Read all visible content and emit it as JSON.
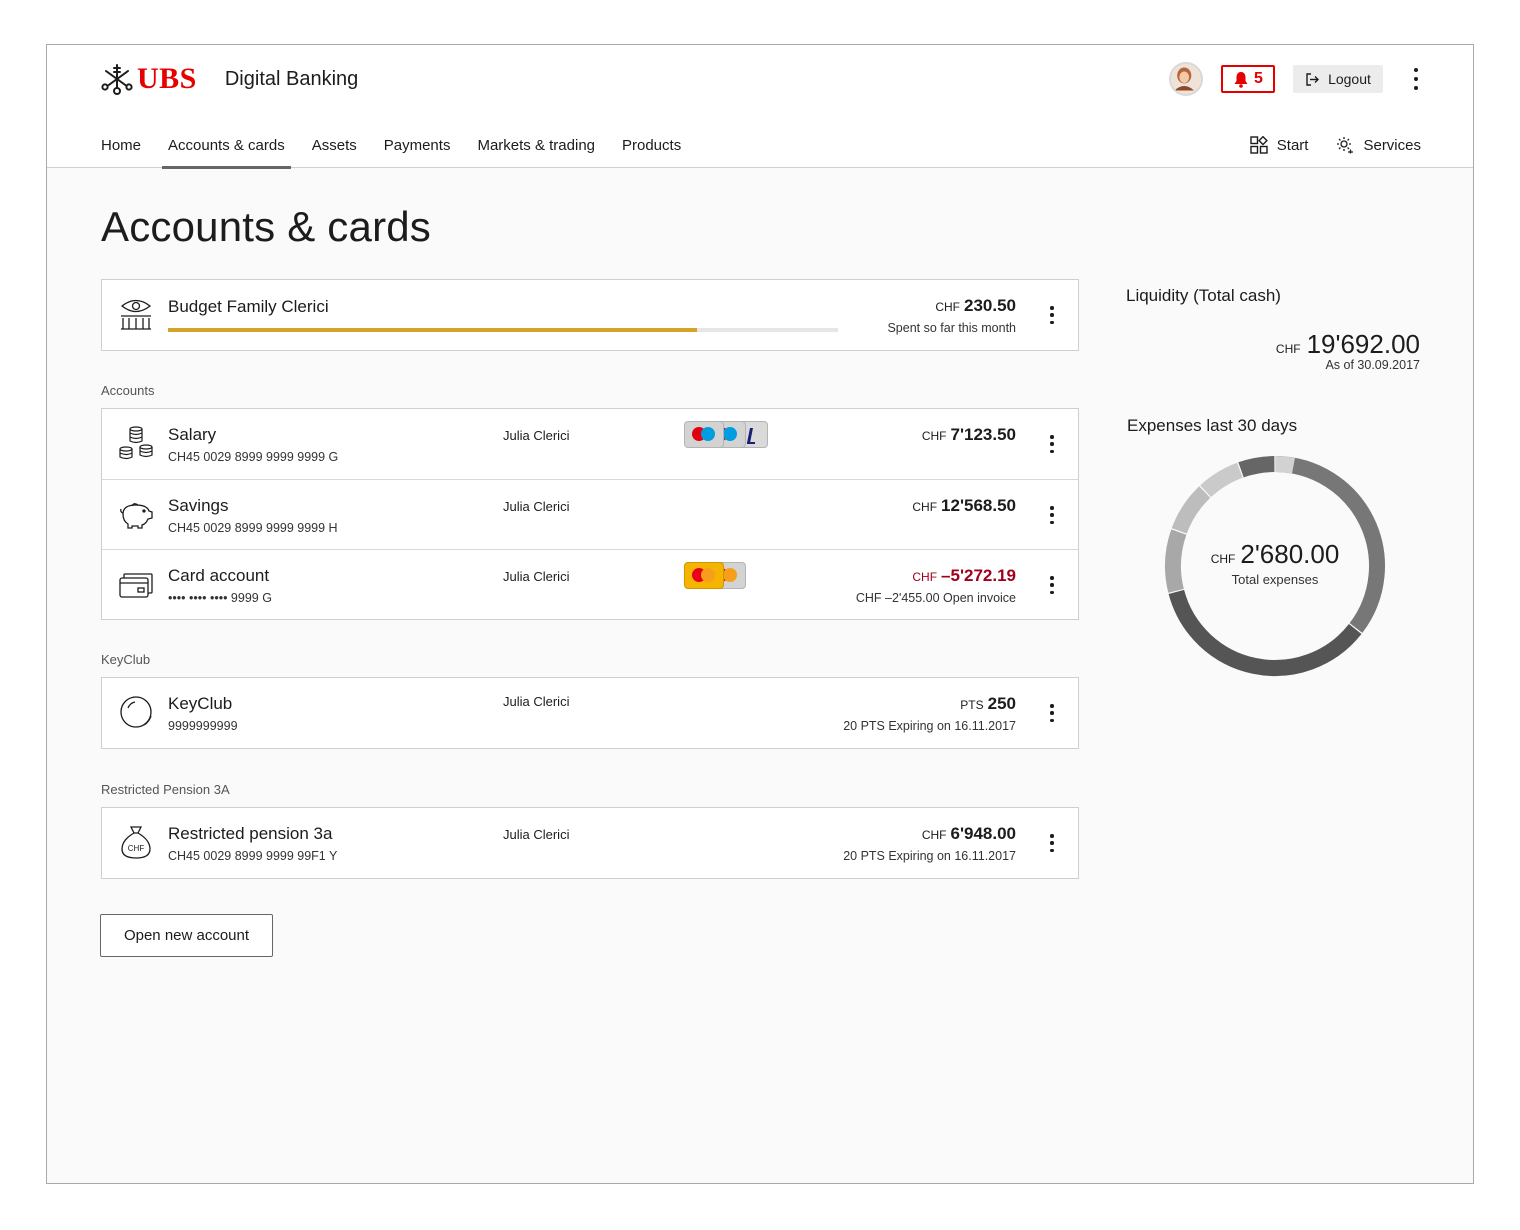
{
  "header": {
    "logo_text": "UBS",
    "app_name": "Digital Banking",
    "notification_count": "5",
    "logout_label": "Logout"
  },
  "nav": {
    "items": [
      {
        "label": "Home"
      },
      {
        "label": "Accounts & cards"
      },
      {
        "label": "Assets"
      },
      {
        "label": "Payments"
      },
      {
        "label": "Markets & trading"
      },
      {
        "label": "Products"
      }
    ],
    "active": "Accounts & cards",
    "start_label": "Start",
    "services_label": "Services"
  },
  "page": {
    "title": "Accounts & cards"
  },
  "budget": {
    "title": "Budget Family Clerici",
    "currency": "CHF",
    "amount": "230.50",
    "note": "Spent so far this month",
    "progress": 0.79,
    "accent_color": "#d4a32a"
  },
  "sections": {
    "accounts": "Accounts",
    "keyclub": "KeyClub",
    "pension": "Restricted Pension 3A"
  },
  "accounts": [
    {
      "title": "Salary",
      "sub": "CH45 0029 8999 9999 9999 G",
      "owner": "Julia Clerici",
      "currency": "CHF",
      "amount": "7'123.50",
      "icon": "coins-icon"
    },
    {
      "title": "Savings",
      "sub": "CH45 0029 8999 9999 9999 H",
      "owner": "Julia Clerici",
      "currency": "CHF",
      "amount": "12'568.50",
      "icon": "piggy-bank-icon"
    },
    {
      "title": "Card account",
      "sub": "•••• •••• •••• 9999 G",
      "owner": "Julia Clerici",
      "currency": "CHF",
      "amount": "–5'272.19",
      "note": "CHF –2'455.00 Open invoice",
      "icon": "cards-icon",
      "amount_color": "#a1001c"
    }
  ],
  "keyclub": {
    "title": "KeyClub",
    "sub": "9999999999",
    "owner": "Julia Clerici",
    "currency": "PTS",
    "amount": "250",
    "note": "20 PTS Expiring on 16.11.2017"
  },
  "pension": {
    "title": "Restricted pension 3a",
    "sub": "CH45 0029 8999 9999 99F1 Y",
    "owner": "Julia Clerici",
    "currency": "CHF",
    "amount": "6'948.00",
    "note": "20 PTS Expiring on 16.11.2017",
    "bag_text": "CHF"
  },
  "open_account_label": "Open new account",
  "liquidity": {
    "title": "Liquidity (Total cash)",
    "currency": "CHF",
    "amount": "19'692.00",
    "as_of": "As of 30.09.2017"
  },
  "expenses": {
    "title": "Expenses last 30 days",
    "currency": "CHF",
    "amount": "2'680.00",
    "label": "Total expenses",
    "segments": [
      {
        "share": 0.355,
        "color": "#777777"
      },
      {
        "share": 0.355,
        "color": "#555555"
      },
      {
        "share": 0.095,
        "color": "#a8a8a8"
      },
      {
        "share": 0.075,
        "color": "#bdbdbd"
      },
      {
        "share": 0.065,
        "color": "#cacaca"
      },
      {
        "share": 0.055,
        "color": "#666666"
      },
      {
        "share": 0.03,
        "color": "#d2d2d2"
      }
    ]
  },
  "colors": {
    "brand_red": "#e60000",
    "negative": "#a1001c"
  }
}
